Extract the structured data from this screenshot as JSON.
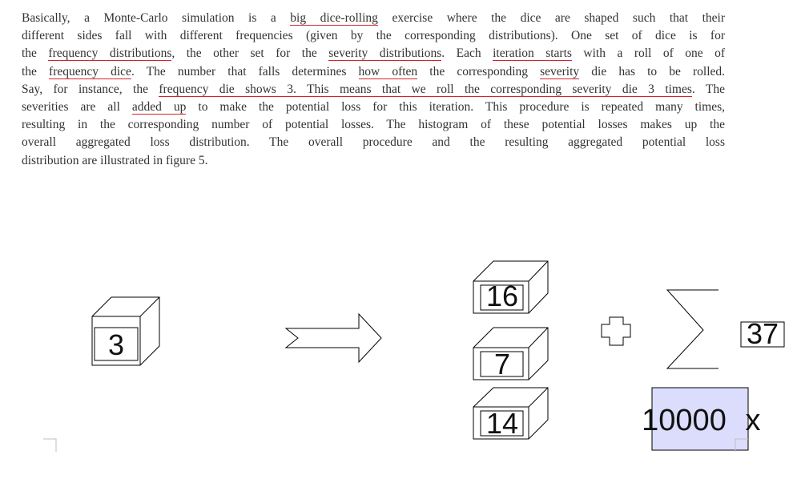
{
  "paragraph": {
    "lines": [
      [
        "Basically, a Monte-Carlo simulation is a ",
        {
          "hl": "big dice-rolling"
        },
        " exercise where the dice are shaped such that their"
      ],
      [
        "different sides fall with different frequencies (given by the corresponding distributions). One set of dice is for"
      ],
      [
        "the ",
        {
          "hl": "frequency distributions"
        },
        ", the other set for the ",
        {
          "hl": "severity distributions"
        },
        ". Each ",
        {
          "hl": "iteration starts"
        },
        " with a roll of one of"
      ],
      [
        "the ",
        {
          "hl": "frequency dice"
        },
        ". The number that falls determines ",
        {
          "hl": "how often"
        },
        " the corresponding ",
        {
          "hl": "severity"
        },
        " die has to be rolled."
      ],
      [
        "Say, for instance, the ",
        {
          "hl": "frequency die shows 3. This means that we roll the corresponding severity die 3 times"
        },
        ". The"
      ],
      [
        "severities are all ",
        {
          "hl": "added up"
        },
        " to make the potential loss for this iteration. This procedure is repeated many times,"
      ],
      [
        "resulting in the corresponding number of potential losses. The histogram of these potential losses makes up the"
      ],
      [
        "overall aggregated loss distribution. The overall procedure and the resulting aggregated potential loss"
      ],
      [
        "distribution are illustrated in figure 5."
      ]
    ]
  },
  "figure": {
    "frequency_die": "3",
    "severity_dice": [
      "16",
      "7",
      "14"
    ],
    "sum_result": "37",
    "iterations": "10000",
    "iterations_suffix": "x",
    "plus_symbol": "plus-icon",
    "sum_symbol": "sigma-icon",
    "arrow_symbol": "right-arrow-icon",
    "colors": {
      "underline": "#d4242a",
      "iterations_box_fill": "#dcdcfc",
      "stroke": "#000000"
    }
  }
}
